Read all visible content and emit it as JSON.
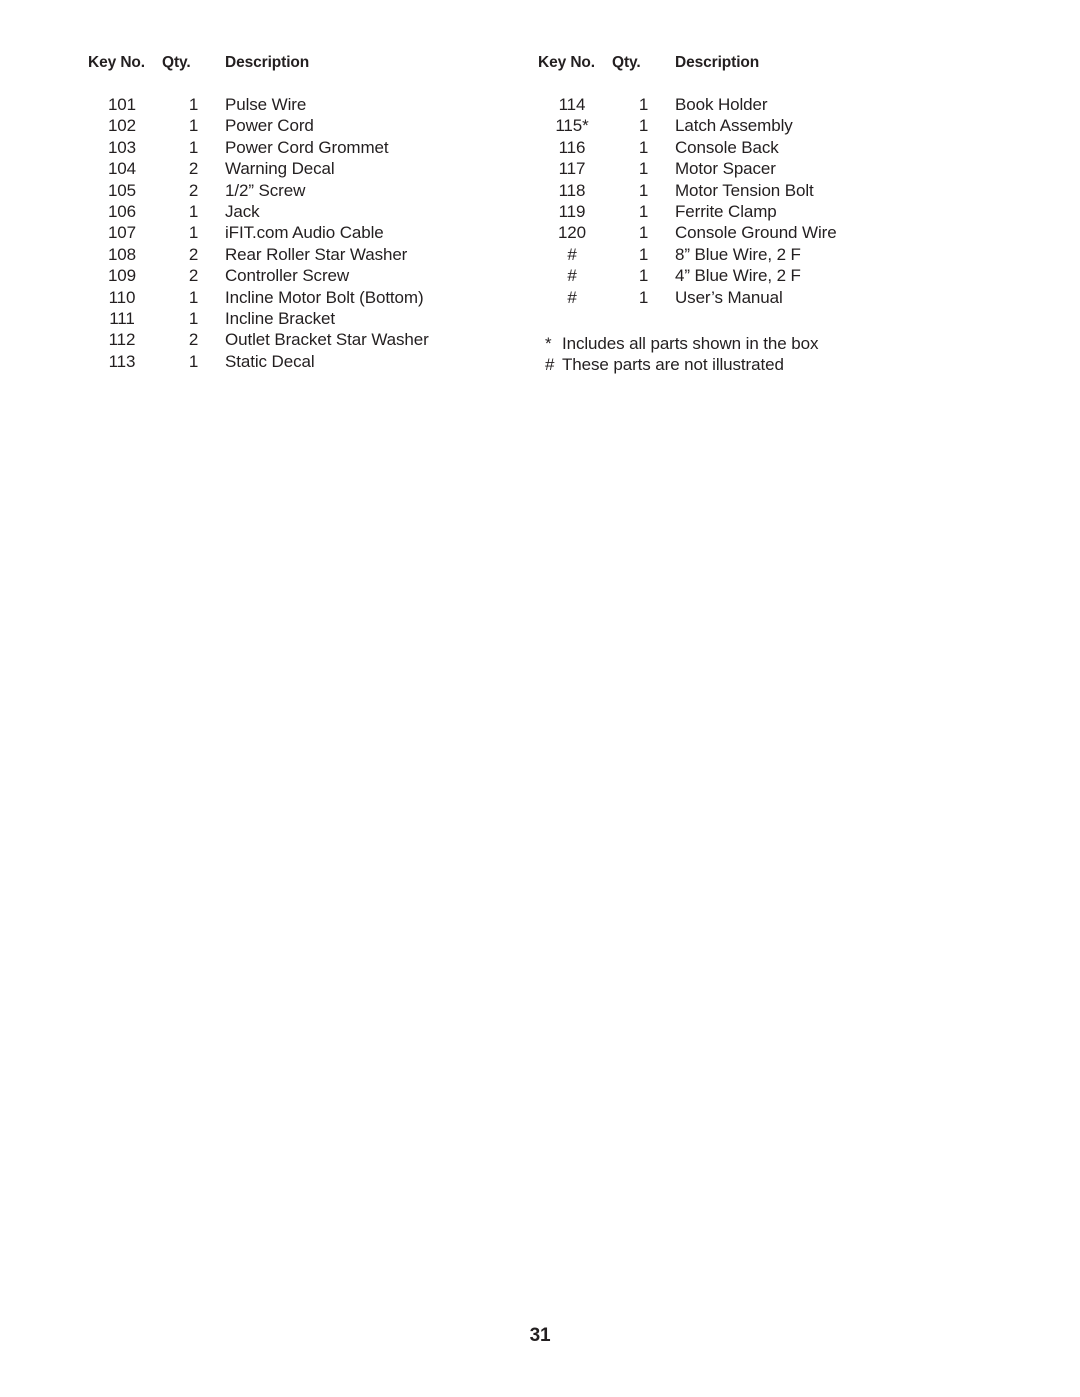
{
  "document": {
    "page_number": "31",
    "text_color": "#231f20",
    "background_color": "#ffffff"
  },
  "columns": [
    {
      "name": "left",
      "headers": {
        "key_no": "Key No.",
        "qty": "Qty.",
        "description": "Description"
      },
      "rows": [
        {
          "key_no": "101",
          "qty": "1",
          "description": "Pulse Wire"
        },
        {
          "key_no": "102",
          "qty": "1",
          "description": "Power Cord"
        },
        {
          "key_no": "103",
          "qty": "1",
          "description": "Power Cord Grommet"
        },
        {
          "key_no": "104",
          "qty": "2",
          "description": "Warning Decal"
        },
        {
          "key_no": "105",
          "qty": "2",
          "description": "1/2” Screw"
        },
        {
          "key_no": "106",
          "qty": "1",
          "description": "Jack"
        },
        {
          "key_no": "107",
          "qty": "1",
          "description": "iFIT.com Audio Cable"
        },
        {
          "key_no": "108",
          "qty": "2",
          "description": "Rear Roller Star Washer"
        },
        {
          "key_no": "109",
          "qty": "2",
          "description": "Controller Screw"
        },
        {
          "key_no": "110",
          "qty": "1",
          "description": "Incline Motor Bolt (Bottom)"
        },
        {
          "key_no": "111",
          "qty": "1",
          "description": "Incline Bracket"
        },
        {
          "key_no": "112",
          "qty": "2",
          "description": "Outlet Bracket Star Washer"
        },
        {
          "key_no": "113",
          "qty": "1",
          "description": "Static Decal"
        }
      ]
    },
    {
      "name": "right",
      "headers": {
        "key_no": "Key No.",
        "qty": "Qty.",
        "description": "Description"
      },
      "rows": [
        {
          "key_no": "114",
          "qty": "1",
          "description": "Book Holder"
        },
        {
          "key_no": "115",
          "key_suffix": "*",
          "qty": "1",
          "description": "Latch Assembly"
        },
        {
          "key_no": "116",
          "qty": "1",
          "description": "Console Back"
        },
        {
          "key_no": "117",
          "qty": "1",
          "description": "Motor Spacer"
        },
        {
          "key_no": "118",
          "qty": "1",
          "description": "Motor Tension Bolt"
        },
        {
          "key_no": "119",
          "qty": "1",
          "description": "Ferrite Clamp"
        },
        {
          "key_no": "120",
          "qty": "1",
          "description": "Console Ground Wire"
        },
        {
          "key_no": "#",
          "qty": "1",
          "description": "8” Blue Wire, 2 F"
        },
        {
          "key_no": "#",
          "qty": "1",
          "description": "4” Blue Wire, 2 F"
        },
        {
          "key_no": "#",
          "qty": "1",
          "description": "User’s Manual"
        }
      ]
    }
  ],
  "footnotes": [
    {
      "mark": "*",
      "text": "Includes all parts shown in the box"
    },
    {
      "mark": "#",
      "text": "These parts are not illustrated"
    }
  ]
}
